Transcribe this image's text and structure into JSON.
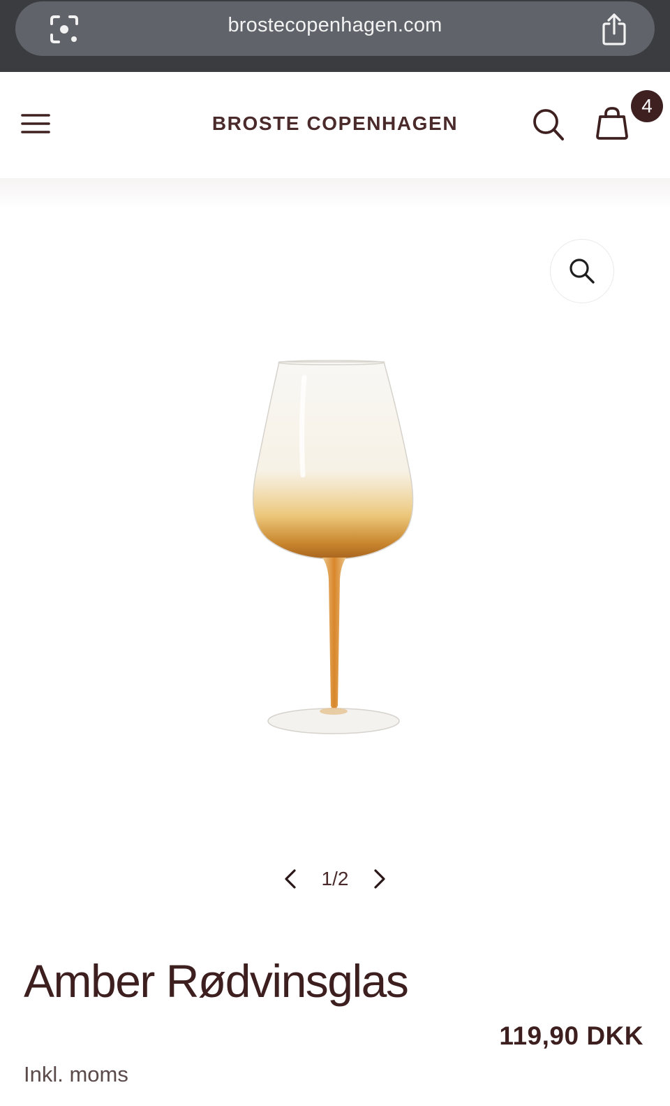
{
  "browser": {
    "url": "brostecopenhagen.com",
    "left_icon": "lens-icon",
    "right_icon": "share-icon"
  },
  "header": {
    "brand": "BROSTE COPENHAGEN",
    "menu_icon": "hamburger-menu-icon",
    "search_icon": "search-icon",
    "cart_icon": "shopping-bag-icon",
    "cart_count": "4"
  },
  "gallery": {
    "zoom_icon": "magnifier-icon",
    "image_alt": "amber wine glass",
    "counter": "1/2",
    "current": 1,
    "total": 2
  },
  "product": {
    "title": "Amber Rødvinsglas",
    "price": "119,90 DKK",
    "vat_note": "Inkl. moms"
  },
  "colors": {
    "brand_text": "#4a2a2a",
    "badge_bg": "#3e2020",
    "browser_bar": "#3a3c3f",
    "url_pill": "#60646a",
    "amber": "#d08a2a"
  }
}
